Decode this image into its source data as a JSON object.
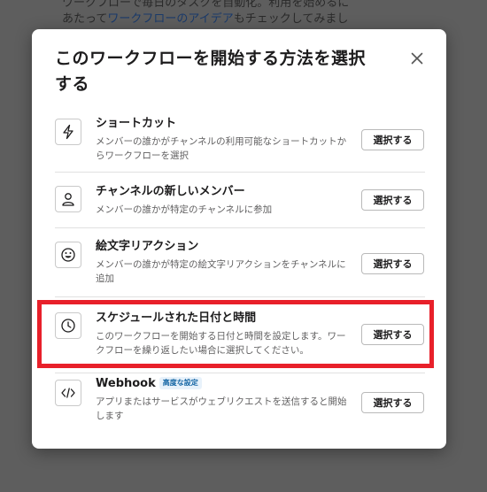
{
  "background": {
    "line1": "ワークフローで毎日のタスクを自動化。利用を始めるに",
    "line2_pre": "あたって",
    "line2_link": "ワークフローのアイデア",
    "line2_post": "もチェックしてみまし"
  },
  "modal": {
    "title": "このワークフローを開始する方法を選択する",
    "close_icon": "close-icon"
  },
  "options": [
    {
      "icon": "lightning-icon",
      "title": "ショートカット",
      "description": "メンバーの誰かがチャンネルの利用可能なショートカットからワークフローを選択",
      "button": "選択する"
    },
    {
      "icon": "person-icon",
      "title": "チャンネルの新しいメンバー",
      "description": "メンバーの誰かが特定のチャンネルに参加",
      "button": "選択する"
    },
    {
      "icon": "smiley-icon",
      "title": "絵文字リアクション",
      "description": "メンバーの誰かが特定の絵文字リアクションをチャンネルに追加",
      "button": "選択する"
    },
    {
      "icon": "clock-icon",
      "title": "スケジュールされた日付と時間",
      "description": "このワークフローを開始する日付と時間を設定します。ワークフローを繰り返したい場合に選択してください。",
      "button": "選択する"
    },
    {
      "icon": "code-icon",
      "title": "Webhook",
      "badge": "高度な設定",
      "description": "アプリまたはサービスがウェブリクエストを送信すると開始します",
      "button": "選択する"
    }
  ],
  "colors": {
    "highlight": "#e8202a",
    "badge_text": "#1264a3",
    "link": "#1a3a6a"
  }
}
